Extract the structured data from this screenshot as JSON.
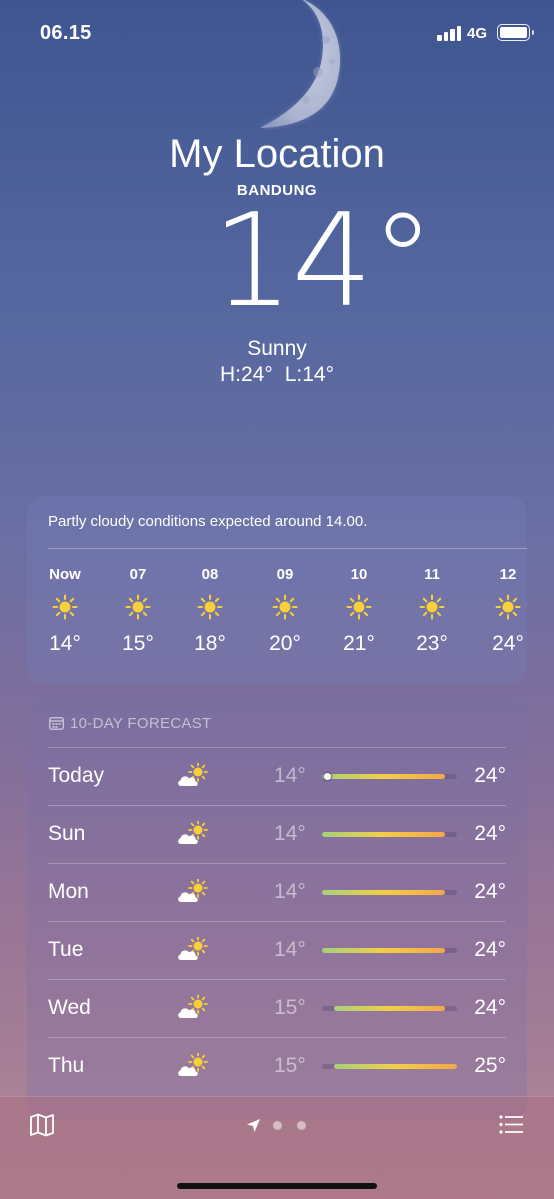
{
  "status_bar": {
    "time": "06.15",
    "network": "4G"
  },
  "header": {
    "title": "My Location",
    "city": "BANDUNG",
    "temperature": "14°",
    "condition": "Sunny",
    "high": "H:24°",
    "low": "L:14°"
  },
  "hourly": {
    "summary": "Partly cloudy conditions expected around 14.00.",
    "items": [
      {
        "time": "Now",
        "icon": "sun-icon",
        "temp": "14°"
      },
      {
        "time": "07",
        "icon": "sun-icon",
        "temp": "15°"
      },
      {
        "time": "08",
        "icon": "sun-icon",
        "temp": "18°"
      },
      {
        "time": "09",
        "icon": "sun-icon",
        "temp": "20°"
      },
      {
        "time": "10",
        "icon": "sun-icon",
        "temp": "21°"
      },
      {
        "time": "11",
        "icon": "sun-icon",
        "temp": "23°"
      },
      {
        "time": "12",
        "icon": "sun-icon",
        "temp": "24°"
      }
    ]
  },
  "forecast": {
    "title": "10-DAY FORECAST",
    "range": {
      "min": 14,
      "max": 25
    },
    "days": [
      {
        "day": "Today",
        "icon": "partly-sunny-icon",
        "low": "14°",
        "high": "24°",
        "low_value": 14,
        "high_value": 24,
        "current_value": 14
      },
      {
        "day": "Sun",
        "icon": "partly-sunny-icon",
        "low": "14°",
        "high": "24°",
        "low_value": 14,
        "high_value": 24
      },
      {
        "day": "Mon",
        "icon": "partly-sunny-icon",
        "low": "14°",
        "high": "24°",
        "low_value": 14,
        "high_value": 24
      },
      {
        "day": "Tue",
        "icon": "partly-sunny-icon",
        "low": "14°",
        "high": "24°",
        "low_value": 14,
        "high_value": 24
      },
      {
        "day": "Wed",
        "icon": "partly-sunny-icon",
        "low": "15°",
        "high": "24°",
        "low_value": 15,
        "high_value": 24
      },
      {
        "day": "Thu",
        "icon": "partly-sunny-icon",
        "low": "15°",
        "high": "25°",
        "low_value": 15,
        "high_value": 25
      }
    ]
  },
  "toolbar": {
    "icons": [
      "map-icon",
      "location-arrow-icon",
      "list-icon"
    ],
    "page_count": 3,
    "current_page": 0
  },
  "colors": {
    "bar_start": "#a6d07b",
    "bar_mid": "#f2cf45",
    "bar_end": "#f4a64a",
    "sun": "#f7d038"
  }
}
